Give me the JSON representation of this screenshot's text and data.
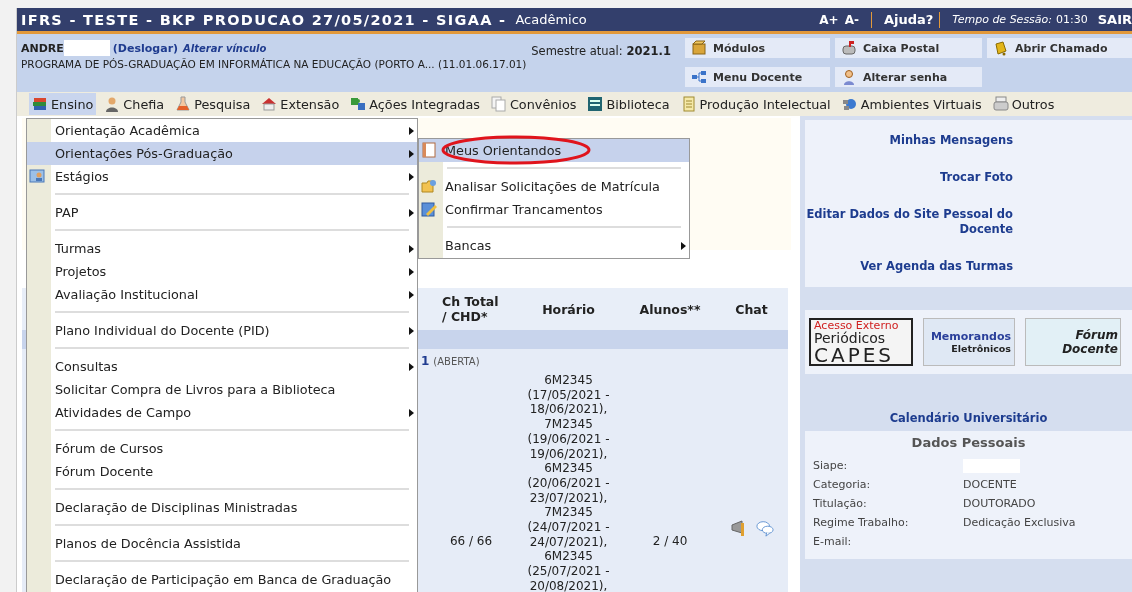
{
  "header": {
    "title": "IFRS - TESTE - BKP PRODUCAO 27/05/2021 - SIGAA -",
    "module": "Acadêmico",
    "font_plus": "A+",
    "font_minus": "A-",
    "help": "Ajuda?",
    "session_label": "Tempo de Sessão:",
    "session_time": "01:30",
    "logout": "SAIR"
  },
  "user": {
    "name": "ANDRE",
    "surname_redacted": true,
    "logout_link": "(Deslogar)",
    "change_link": "Alterar vínculo",
    "unit": "PROGRAMA DE PÓS-GRADUAÇÃO EM INFORMÁTICA NA EDUCAÇÃO (PORTO A... (11.01.06.17.01)",
    "semester_label": "Semestre atual:",
    "semester": "2021.1"
  },
  "shortcuts": [
    {
      "label": "Módulos"
    },
    {
      "label": "Caixa Postal"
    },
    {
      "label": "Abrir Chamado"
    },
    {
      "label": "Menu Docente"
    },
    {
      "label": "Alterar senha"
    }
  ],
  "menubar": [
    {
      "label": "Ensino",
      "selected": true
    },
    {
      "label": "Chefia",
      "selected": false
    },
    {
      "label": "Pesquisa",
      "selected": false
    },
    {
      "label": "Extensão",
      "selected": false
    },
    {
      "label": "Ações Integradas",
      "selected": false
    },
    {
      "label": "Convênios",
      "selected": false
    },
    {
      "label": "Biblioteca",
      "selected": false
    },
    {
      "label": "Produção Intelectual",
      "selected": false
    },
    {
      "label": "Ambientes Virtuais",
      "selected": false
    },
    {
      "label": "Outros",
      "selected": false
    }
  ],
  "menu": {
    "groups": [
      [
        {
          "label": "Orientação Acadêmica",
          "kind": "plain",
          "has_submenu": true,
          "selected": false
        },
        {
          "label": "Orientações Pós-Graduação",
          "kind": "plain",
          "has_submenu": true,
          "selected": true
        },
        {
          "label": "Estágios",
          "kind": "badge",
          "has_submenu": true,
          "selected": false
        }
      ],
      [
        {
          "label": "PAP",
          "kind": "plain",
          "has_submenu": true,
          "selected": false
        }
      ],
      [
        {
          "label": "Turmas",
          "kind": "plain",
          "has_submenu": true,
          "selected": false
        },
        {
          "label": "Projetos",
          "kind": "plain",
          "has_submenu": true,
          "selected": false
        },
        {
          "label": "Avaliação Institucional",
          "kind": "plain",
          "has_submenu": true,
          "selected": false
        }
      ],
      [
        {
          "label": "Plano Individual do Docente (PID)",
          "kind": "plain",
          "has_submenu": true,
          "selected": false
        }
      ],
      [
        {
          "label": "Consultas",
          "kind": "plain",
          "has_submenu": true,
          "selected": false
        },
        {
          "label": "Solicitar Compra de Livros para a Biblioteca",
          "kind": "plain",
          "has_submenu": false,
          "selected": false
        },
        {
          "label": "Atividades de Campo",
          "kind": "plain",
          "has_submenu": true,
          "selected": false
        }
      ],
      [
        {
          "label": "Fórum de Cursos",
          "kind": "plain",
          "has_submenu": false,
          "selected": false
        },
        {
          "label": "Fórum Docente",
          "kind": "plain",
          "has_submenu": false,
          "selected": false
        }
      ],
      [
        {
          "label": "Declaração de Disciplinas Ministradas",
          "kind": "plain",
          "has_submenu": false,
          "selected": false
        }
      ],
      [
        {
          "label": "Planos de Docência Assistida",
          "kind": "plain",
          "has_submenu": false,
          "selected": false
        }
      ],
      [
        {
          "label": "Declaração de Participação em Banca de Graduação",
          "kind": "plain",
          "has_submenu": false,
          "selected": false
        }
      ]
    ]
  },
  "submenu": {
    "groups": [
      [
        {
          "label": "Meus Orientandos",
          "kind": "page",
          "has_submenu": false,
          "selected": true,
          "circled": true
        }
      ],
      [
        {
          "label": "Analisar Solicitações de Matrícula",
          "kind": "folder",
          "has_submenu": false,
          "selected": false,
          "circled": false
        },
        {
          "label": "Confirmar Trancamentos",
          "kind": "edit",
          "has_submenu": false,
          "selected": false,
          "circled": false
        }
      ],
      [
        {
          "label": "Bancas",
          "kind": "plain",
          "has_submenu": true,
          "selected": false,
          "circled": false
        }
      ]
    ]
  },
  "table": {
    "columns": [
      "Ch Total / CHD*",
      "Horário",
      "Alunos**",
      "Chat"
    ],
    "class_row": {
      "code": "1",
      "status": "(ABERTA)"
    },
    "rows": [
      {
        "workload": "66 / 66",
        "schedule": "6M2345\n(17/05/2021 -\n18/06/2021),\n7M2345\n(19/06/2021 -\n19/06/2021),\n6M2345\n(20/06/2021 -\n23/07/2021),\n7M2345\n(24/07/2021 -\n24/07/2021),\n6M2345\n(25/07/2021 -\n20/08/2021),",
        "students": "2 / 40"
      }
    ]
  },
  "sidebar": {
    "links": [
      "Minhas Mensagens",
      "Trocar Foto",
      "Editar Dados do Site Pessoal do Docente",
      "Ver Agenda das Turmas"
    ],
    "banners": [
      {
        "kind": "capes",
        "lines": [
          "Acesso Externo",
          "Periódicos",
          "CAPES"
        ]
      },
      {
        "kind": "memo",
        "lines": [
          "Memorandos",
          "Eletrônicos"
        ]
      },
      {
        "kind": "forum",
        "lines": [
          "Fórum",
          "Docente"
        ]
      }
    ],
    "calendar_link": "Calendário Universitário",
    "personal": {
      "title": "Dados Pessoais",
      "fields": [
        {
          "label": "Siape:",
          "redacted": true
        },
        {
          "label": "Categoria:",
          "value": "DOCENTE",
          "redacted": false
        },
        {
          "label": "Titulação:",
          "value": "DOUTORADO",
          "redacted": false
        },
        {
          "label": "Regime Trabalho:",
          "value": "Dedicação Exclusiva",
          "redacted": false
        },
        {
          "label": "E-mail:",
          "redacted": false
        }
      ]
    }
  }
}
